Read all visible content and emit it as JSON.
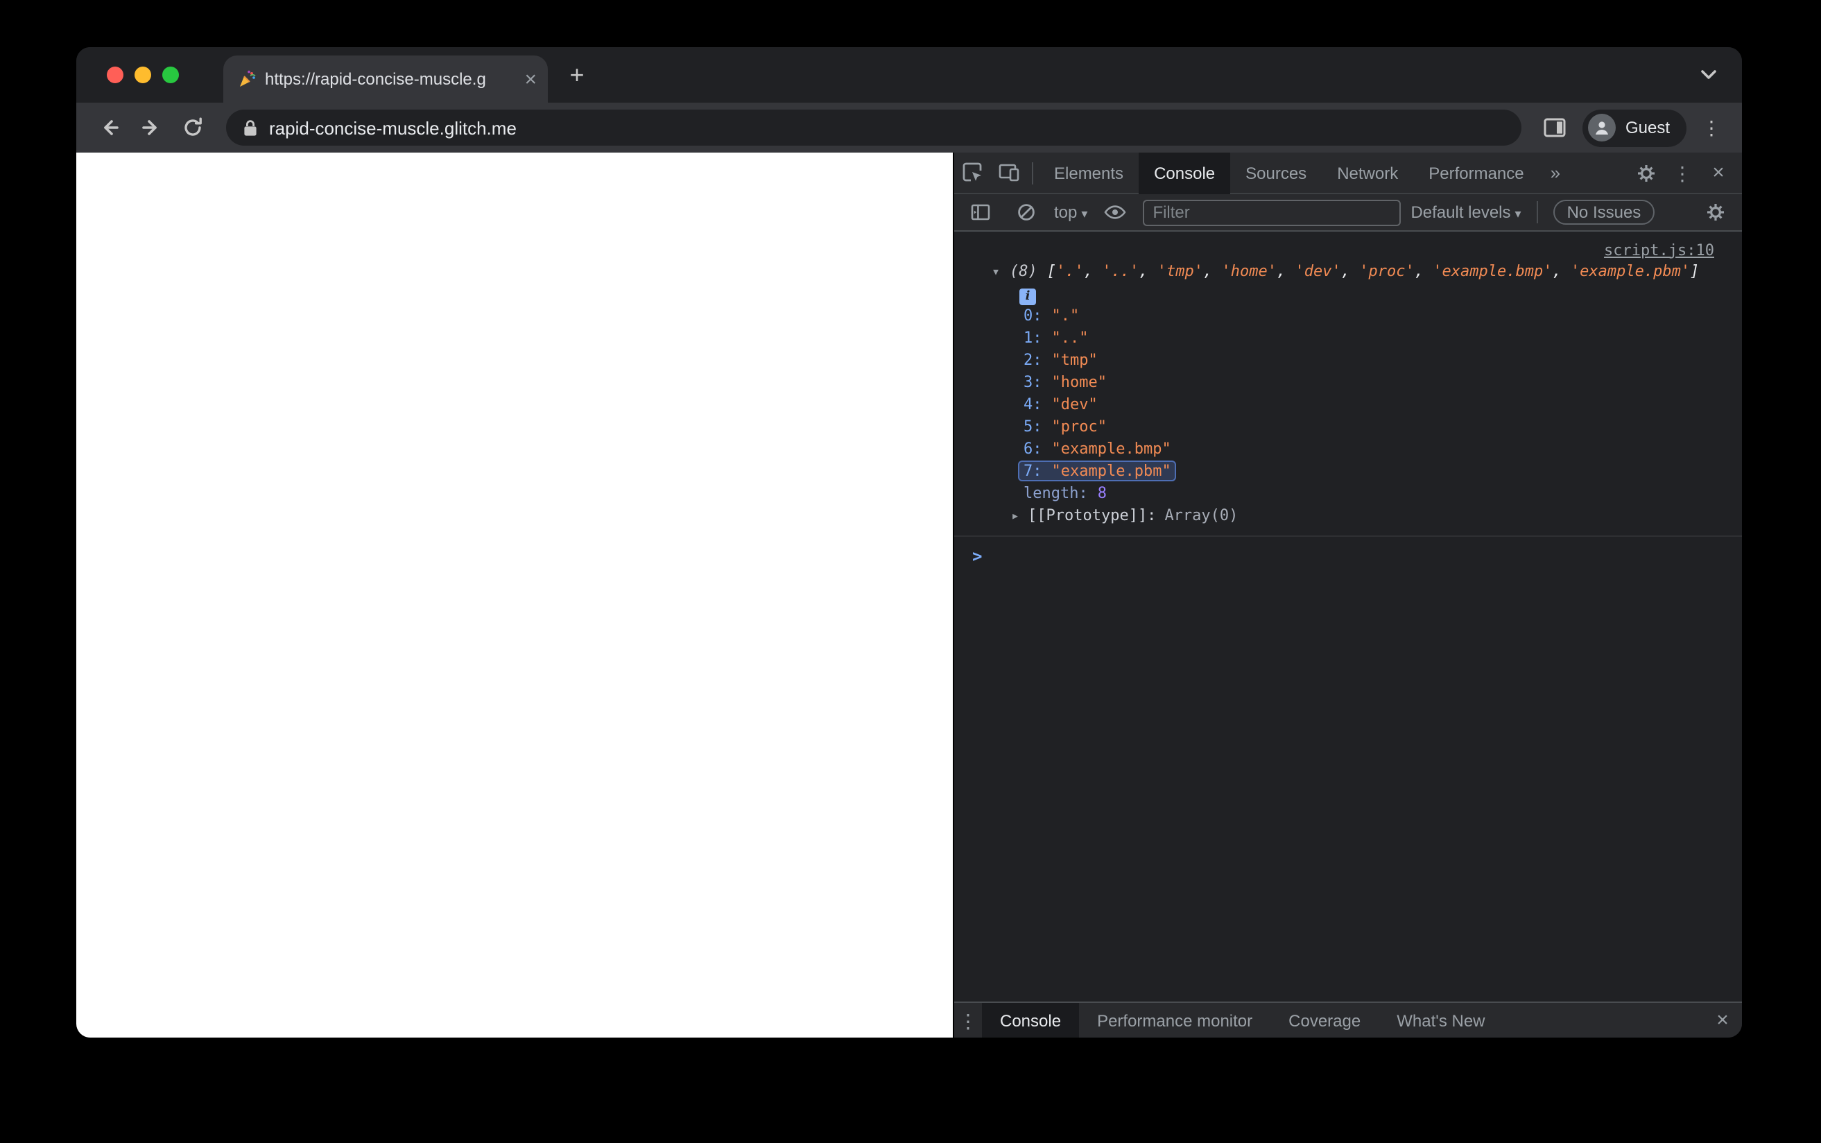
{
  "window_controls": {
    "close_color": "#ff5f57",
    "minimize_color": "#febc2e",
    "maximize_color": "#28c840"
  },
  "browser": {
    "tab_title": "https://rapid-concise-muscle.g",
    "favicon": "party-popper",
    "url": "rapid-concise-muscle.glitch.me",
    "profile_label": "Guest"
  },
  "devtools": {
    "panel_tabs": {
      "items": [
        "Elements",
        "Console",
        "Sources",
        "Network",
        "Performance"
      ],
      "active": "Console"
    },
    "toolbar": {
      "context_selector": "top",
      "filter_placeholder": "Filter",
      "levels_selector": "Default levels",
      "issues_badge": "No Issues"
    },
    "console": {
      "source_link": "script.js:10",
      "preview": {
        "count": "(8)",
        "open": "[",
        "separator": ", ",
        "close": "]",
        "items": [
          "'.'",
          "'..'",
          "'tmp'",
          "'home'",
          "'dev'",
          "'proc'",
          "'example.bmp'",
          "'example.pbm'"
        ]
      },
      "entries": [
        {
          "key": "0:",
          "value": "\".\""
        },
        {
          "key": "1:",
          "value": "\"..\""
        },
        {
          "key": "2:",
          "value": "\"tmp\""
        },
        {
          "key": "3:",
          "value": "\"home\""
        },
        {
          "key": "4:",
          "value": "\"dev\""
        },
        {
          "key": "5:",
          "value": "\"proc\""
        },
        {
          "key": "6:",
          "value": "\"example.bmp\""
        },
        {
          "key": "7:",
          "value": "\"example.pbm\"",
          "highlighted": true
        }
      ],
      "length_key": "length:",
      "length_value": "8",
      "prototype_key": "[[Prototype]]:",
      "prototype_value": "Array(0)",
      "prompt": ">"
    },
    "drawer_tabs": {
      "items": [
        "Console",
        "Performance monitor",
        "Coverage",
        "What's New"
      ],
      "active": "Console"
    }
  },
  "colors": {
    "accent_blue": "#7cacf8",
    "console_string": "#f28b54",
    "console_number": "#9980ff",
    "toolbar_bg": "#35363a",
    "devtools_bg": "#202124",
    "highlight_border": "#4e6eb3"
  }
}
